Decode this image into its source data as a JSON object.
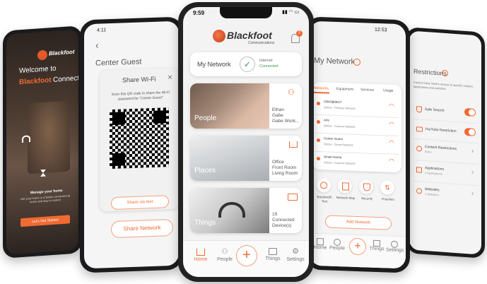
{
  "colors": {
    "accent": "#f06a32",
    "green": "#3a9a4a",
    "phone_frame": "#1b1b1d"
  },
  "brand": {
    "name": "Blackfoot",
    "sub": "Communications"
  },
  "phone1": {
    "welcome": "Welcome to",
    "brand": "Blackfoot",
    "product": "Connect",
    "manage_title": "Manage your home",
    "manage_desc": "Get your home or a family connected at home and stay in control",
    "cta": "Let's Get Started"
  },
  "phone2": {
    "time": "4:11",
    "title": "Center Guest",
    "modal_title": "Share Wi-Fi",
    "modal_text": "Scan this QR code to share the Wi-Fi password for \"Center Guest\"",
    "share_text_btn": "Share via text",
    "share_network_btn": "Share Network"
  },
  "phone3": {
    "time": "9:59",
    "notification_count": "2",
    "network_label": "My Network",
    "internet_label": "Internet",
    "internet_status": "Connected",
    "people_label": "People",
    "people_names": [
      "Ethan",
      "Gabe",
      "Gabe Work..."
    ],
    "places_label": "Places",
    "places_names": [
      "Office",
      "Front Room",
      "Living Room"
    ],
    "things_label": "Things",
    "things_count": "19",
    "things_desc": [
      "Connected",
      "Device(s)"
    ],
    "nav": [
      "Home",
      "People",
      "Things",
      "Settings"
    ]
  },
  "phone4": {
    "time": "12:53",
    "title": "My Network",
    "tabs": [
      "Networks",
      "Equipment",
      "Services",
      "Usage"
    ],
    "networks": [
      {
        "name": "CBK6800GT",
        "status": "Online - Primary Network"
      },
      {
        "name": "Arlo",
        "status": "Online - Custom Network"
      },
      {
        "name": "Center Guest",
        "status": "Online - Guest Network"
      },
      {
        "name": "Smart Home",
        "status": "Online - Custom Network"
      }
    ],
    "actions": [
      {
        "label": "Bandwidth Test",
        "icon": "gauge-icon"
      },
      {
        "label": "Network Map",
        "icon": "map-icon"
      },
      {
        "label": "Security",
        "icon": "shield-icon"
      },
      {
        "label": "Priorities",
        "icon": "sort-icon"
      }
    ],
    "add_network": "Add Network",
    "nav": [
      "Home",
      "People",
      "Things",
      "Settings"
    ]
  },
  "phone5": {
    "title": "Restrictions",
    "desc": "Control Gabe Work's access to specific content, applications and websites.",
    "items": [
      {
        "label": "Safe Search",
        "sub": "",
        "type": "toggle"
      },
      {
        "label": "YouTube Restriction",
        "sub": "",
        "type": "toggle"
      },
      {
        "label": "Content Restrictions",
        "sub": "None",
        "type": "chevron"
      },
      {
        "label": "Applications",
        "sub": "4 Applications",
        "type": "chevron"
      },
      {
        "label": "Websites",
        "sub": "1 Websites",
        "type": "chevron"
      }
    ]
  }
}
